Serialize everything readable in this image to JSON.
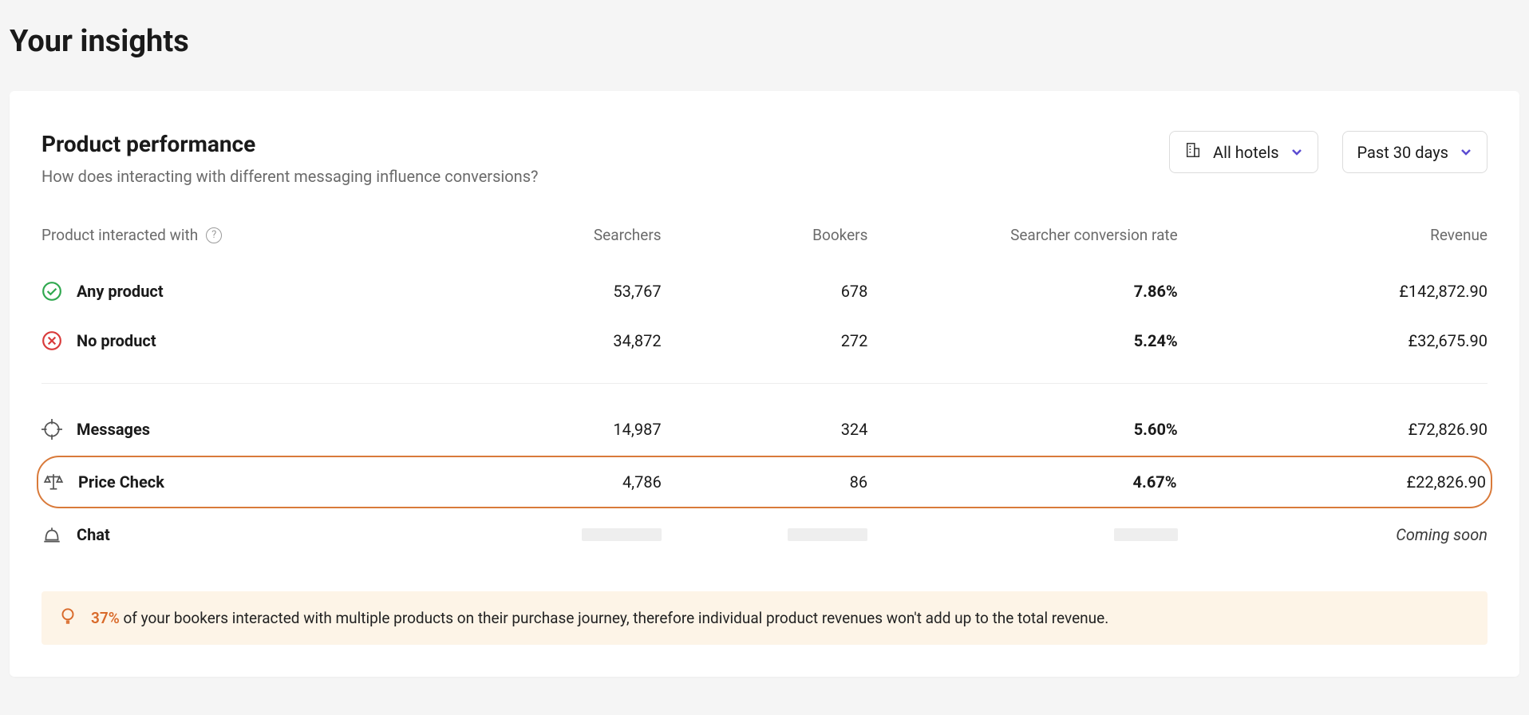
{
  "page": {
    "title": "Your insights"
  },
  "card": {
    "title": "Product performance",
    "subtitle": "How does interacting with different messaging influence conversions?"
  },
  "filters": {
    "hotels_label": "All hotels",
    "period_label": "Past 30 days"
  },
  "columns": {
    "product": "Product interacted with",
    "searchers": "Searchers",
    "bookers": "Bookers",
    "conversion": "Searcher conversion rate",
    "revenue": "Revenue"
  },
  "rows_summary": [
    {
      "name": "Any product",
      "searchers": "53,767",
      "bookers": "678",
      "conversion": "7.86%",
      "revenue": "£142,872.90",
      "icon": "check-green"
    },
    {
      "name": "No product",
      "searchers": "34,872",
      "bookers": "272",
      "conversion": "5.24%",
      "revenue": "£32,675.90",
      "icon": "cross-red"
    }
  ],
  "rows_products": [
    {
      "name": "Messages",
      "searchers": "14,987",
      "bookers": "324",
      "conversion": "5.60%",
      "revenue": "£72,826.90",
      "icon": "target"
    },
    {
      "name": "Price Check",
      "searchers": "4,786",
      "bookers": "86",
      "conversion": "4.67%",
      "revenue": "£22,826.90",
      "icon": "scales",
      "highlighted": true
    },
    {
      "name": "Chat",
      "coming_soon": "Coming soon",
      "icon": "bell"
    }
  ],
  "hint": {
    "pct": "37%",
    "text": " of your bookers interacted with multiple products on their purchase journey, therefore individual product revenues won't add up to the total revenue."
  }
}
